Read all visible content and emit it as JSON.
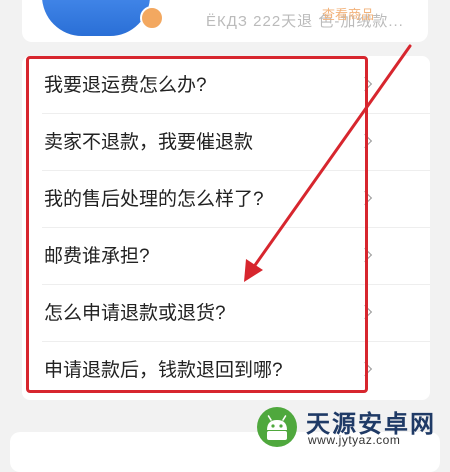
{
  "colors": {
    "background": "#f2f2f2",
    "card": "#ffffff",
    "text": "#222222",
    "chevron": "#9a9a9a",
    "annotation_red": "#d7262e",
    "watermark_green": "#4fa83d",
    "watermark_navy": "#1f3a66"
  },
  "top_card": {
    "avatar_icon": "avatar-icon",
    "text": "ЁКДЗ 222天退 色-加绒款...",
    "link": "查看商品"
  },
  "faq": {
    "items": [
      {
        "label": "我要退运费怎么办?",
        "icon": "chevron-right-icon"
      },
      {
        "label": "卖家不退款，我要催退款",
        "icon": "chevron-right-icon"
      },
      {
        "label": "我的售后处理的怎么样了?",
        "icon": "chevron-right-icon"
      },
      {
        "label": "邮费谁承担?",
        "icon": "chevron-right-icon"
      },
      {
        "label": "怎么申请退款或退货?",
        "icon": "chevron-right-icon"
      },
      {
        "label": "申请退款后，钱款退回到哪?",
        "icon": "chevron-right-icon"
      }
    ]
  },
  "watermark": {
    "title": "天源安卓网",
    "url": "www.jytyaz.com",
    "logo_icon": "android-logo-icon"
  }
}
